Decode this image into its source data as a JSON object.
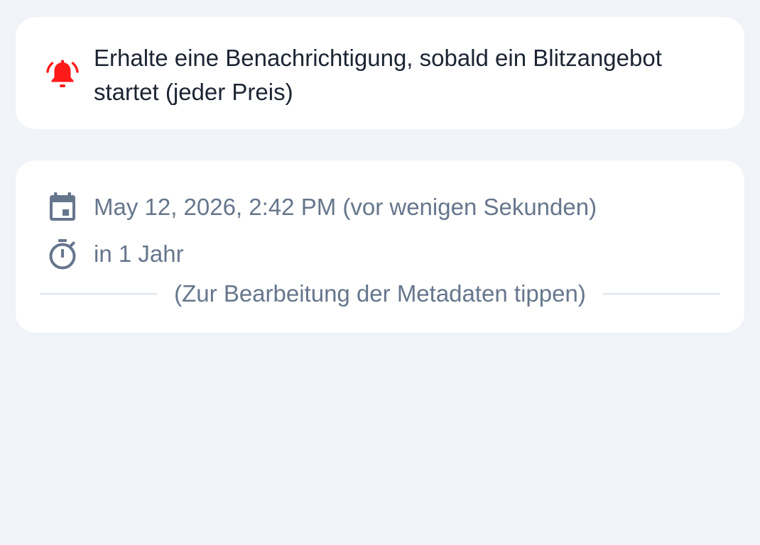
{
  "alert": {
    "icon": "bell-ringing-icon",
    "icon_color": "#ff1a1a",
    "text": "Erhalte eine Benachrichtigung, sobald ein Blitzangebot startet (jeder Preis)"
  },
  "metadata": {
    "created": {
      "icon": "calendar-icon",
      "text": "May 12, 2026, 2:42 PM (vor wenigen Sekunden)"
    },
    "duration": {
      "icon": "stopwatch-icon",
      "text": "in 1 Jahr"
    },
    "edit_hint": "(Zur Bearbeitung der Metadaten tippen)"
  },
  "colors": {
    "background": "#f0f3f8",
    "card": "#ffffff",
    "primary_text": "#1c2433",
    "secondary_text": "#66768c",
    "divider": "#dde5ef"
  }
}
